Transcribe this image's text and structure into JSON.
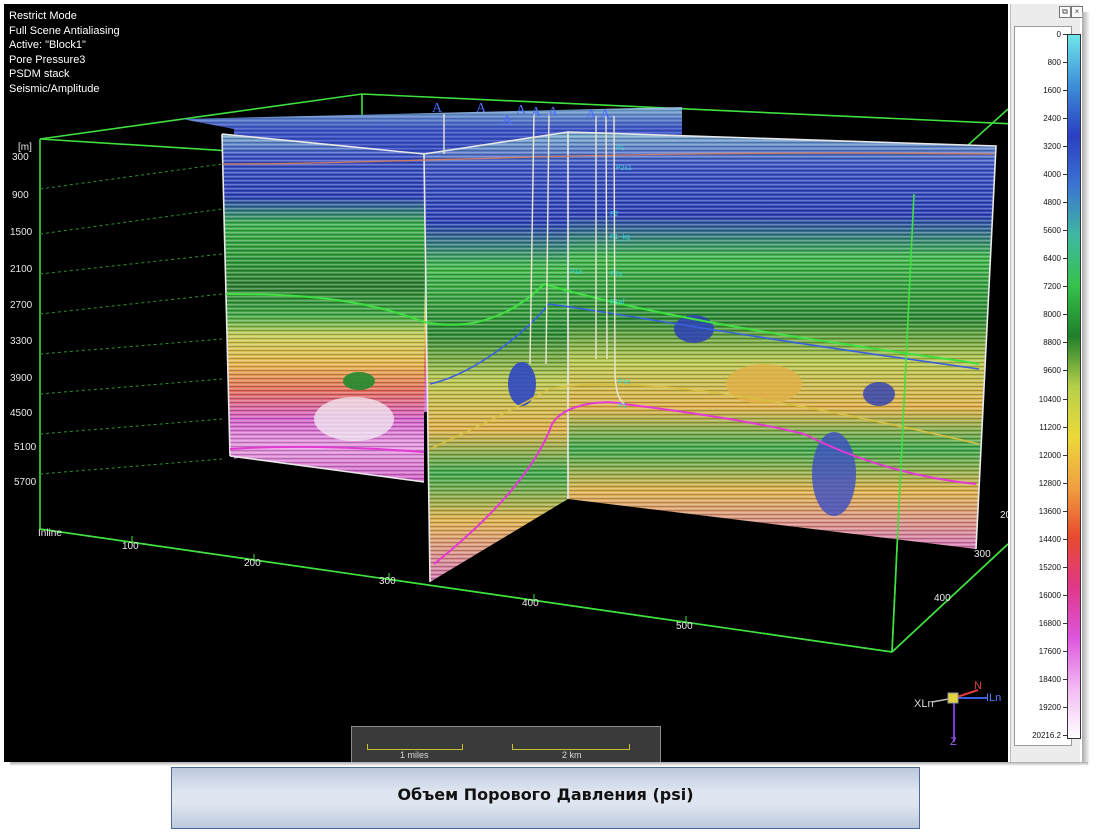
{
  "viewer": {
    "info_lines": [
      "Restrict Mode",
      "Full Scene Antialiasing",
      "Active: \"Block1\"",
      "Pore Pressure3",
      "PSDM stack",
      "Seismic/Amplitude"
    ],
    "depth_unit": "[m]",
    "depth_ticks": [
      "300",
      "900",
      "1500",
      "2100",
      "2700",
      "3300",
      "3900",
      "4500",
      "5100",
      "5700"
    ],
    "inline_axis_label": "Inline",
    "inline_ticks": [
      "100",
      "200",
      "300",
      "400",
      "500"
    ],
    "crossline_ticks": [
      "200",
      "300",
      "400"
    ],
    "wells": [
      "A",
      "A",
      "A",
      "A",
      "A",
      "A",
      "A",
      "A"
    ],
    "well_subscripts": [
      "U1",
      "8",
      "5",
      "7",
      "1",
      "5",
      "8",
      "1"
    ],
    "horizon_labels": [
      "P1",
      "P2s1",
      "P2",
      "P1_kg",
      "P1a",
      "P1a",
      "P1af",
      "P1e",
      "P1"
    ],
    "scale_bar": {
      "miles_label": "1 miles",
      "km_label": "2 km"
    },
    "compass": {
      "north": "N",
      "inline": "ILn",
      "crossline": "XLn",
      "depth": "Z"
    }
  },
  "colorbar": {
    "labels": [
      "0",
      "800",
      "1600",
      "2400",
      "3200",
      "4000",
      "4800",
      "5600",
      "6400",
      "7200",
      "8000",
      "8800",
      "9600",
      "10400",
      "11200",
      "12000",
      "12800",
      "13600",
      "14400",
      "15200",
      "16000",
      "16800",
      "17600",
      "18400",
      "19200",
      "20216.2"
    ],
    "colors": [
      "#6fe6ea",
      "#3d8fd8",
      "#2a3fc2",
      "#3b74d2",
      "#3fb8a0",
      "#35c24a",
      "#1f7f2a",
      "#b6d04a",
      "#ecd93a",
      "#f0a040",
      "#e84a2e",
      "#e0388a",
      "#dd55dd",
      "#f3b9f3",
      "#ffffff"
    ]
  },
  "caption": "Объем Порового  Давления (psi)"
}
